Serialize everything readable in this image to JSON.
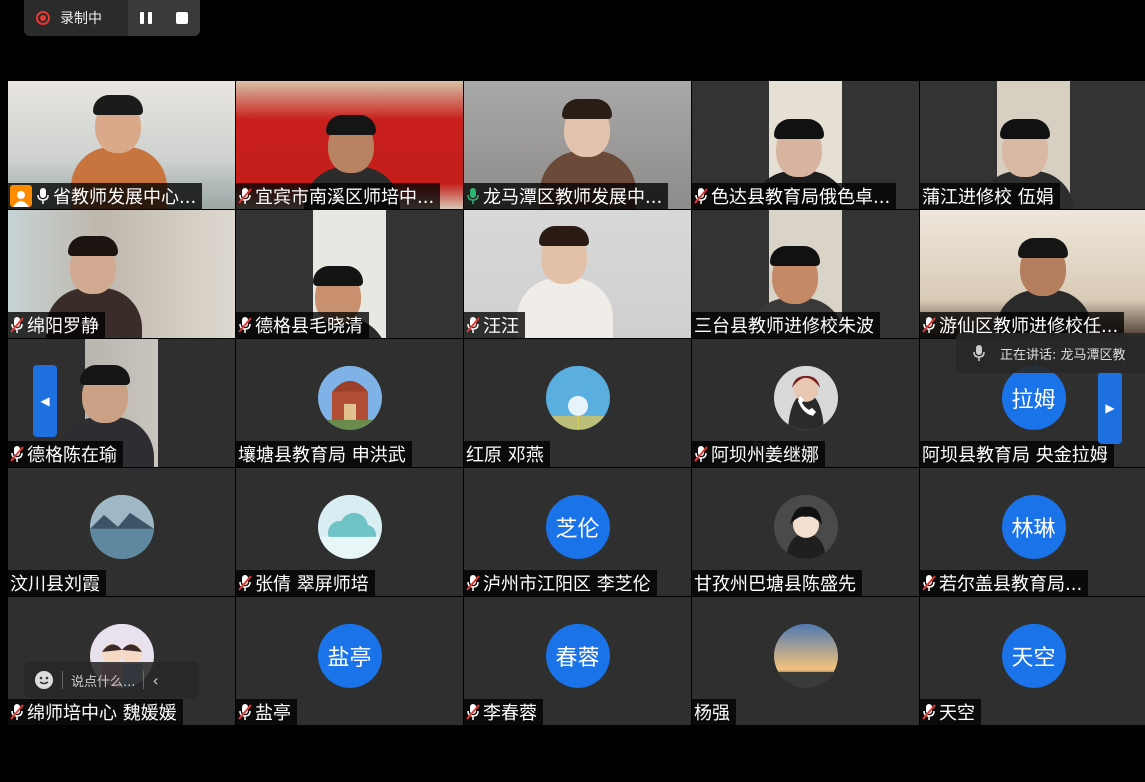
{
  "recording": {
    "label": "录制中",
    "pause_icon": "pause-icon",
    "stop_icon": "stop-icon"
  },
  "speaking": {
    "text": "正在讲话: 龙马潭区教"
  },
  "chat": {
    "placeholder": "说点什么...",
    "collapse_glyph": "‹"
  },
  "call_hint": "电话",
  "navigation": {
    "prev_glyph": "◀",
    "next_glyph": "▶"
  },
  "colors": {
    "accent_blue": "#1a73e8",
    "active_speaker_border": "#2bb673",
    "record_red": "#e53935",
    "host_orange": "#ff8a00"
  },
  "participants": [
    {
      "name": "省教师发展中心...",
      "mic": "on",
      "host": true,
      "type": "video"
    },
    {
      "name": "宜宾市南溪区师培中...",
      "mic": "off",
      "type": "video"
    },
    {
      "name": "龙马潭区教师发展中...",
      "mic": "speaking",
      "type": "video",
      "active": true
    },
    {
      "name": "色达县教育局俄色卓...",
      "mic": "off",
      "type": "video"
    },
    {
      "name": "蒲江进修校 伍娟",
      "mic": "none",
      "type": "video"
    },
    {
      "name": "绵阳罗静",
      "mic": "off",
      "type": "video"
    },
    {
      "name": "德格县毛晓清",
      "mic": "off",
      "type": "video"
    },
    {
      "name": "汪汪",
      "mic": "off",
      "type": "video"
    },
    {
      "name": "三台县教师进修校朱波",
      "mic": "none",
      "type": "video"
    },
    {
      "name": "游仙区教师进修校任...",
      "mic": "off",
      "type": "video"
    },
    {
      "name": "德格陈在瑜",
      "mic": "off",
      "type": "video"
    },
    {
      "name": "壤塘县教育局 申洪武",
      "mic": "none",
      "type": "image-avatar",
      "avatar": "building-avatar"
    },
    {
      "name": "红原 邓燕",
      "mic": "none",
      "type": "image-avatar",
      "avatar": "dandelion-avatar"
    },
    {
      "name": "阿坝州姜继娜",
      "mic": "off",
      "type": "image-avatar",
      "avatar": "phone-avatar"
    },
    {
      "name": "阿坝县教育局 央金拉姆",
      "mic": "none",
      "type": "text-avatar",
      "avatar_text": "拉姆"
    },
    {
      "name": "汶川县刘霞",
      "mic": "none",
      "type": "image-avatar",
      "avatar": "lake-avatar"
    },
    {
      "name": "张倩 翠屏师培",
      "mic": "off",
      "type": "image-avatar",
      "avatar": "cloud-avatar"
    },
    {
      "name": "泸州市江阳区 李芝伦",
      "mic": "off",
      "type": "text-avatar",
      "avatar_text": "芝伦"
    },
    {
      "name": "甘孜州巴塘县陈盛先",
      "mic": "none",
      "type": "image-avatar",
      "avatar": "anime-avatar"
    },
    {
      "name": "若尔盖县教育局...",
      "mic": "off",
      "type": "text-avatar",
      "avatar_text": "林琳"
    },
    {
      "name": "绵师培中心 魏媛媛",
      "mic": "off",
      "type": "image-avatar",
      "avatar": "cartoon-avatar"
    },
    {
      "name": "盐亭",
      "mic": "off",
      "type": "text-avatar",
      "avatar_text": "盐亭"
    },
    {
      "name": "李春蓉",
      "mic": "off",
      "type": "text-avatar",
      "avatar_text": "春蓉"
    },
    {
      "name": "杨强",
      "mic": "none",
      "type": "image-avatar",
      "avatar": "sky-avatar"
    },
    {
      "name": "天空",
      "mic": "off",
      "type": "text-avatar",
      "avatar_text": "天空"
    }
  ]
}
